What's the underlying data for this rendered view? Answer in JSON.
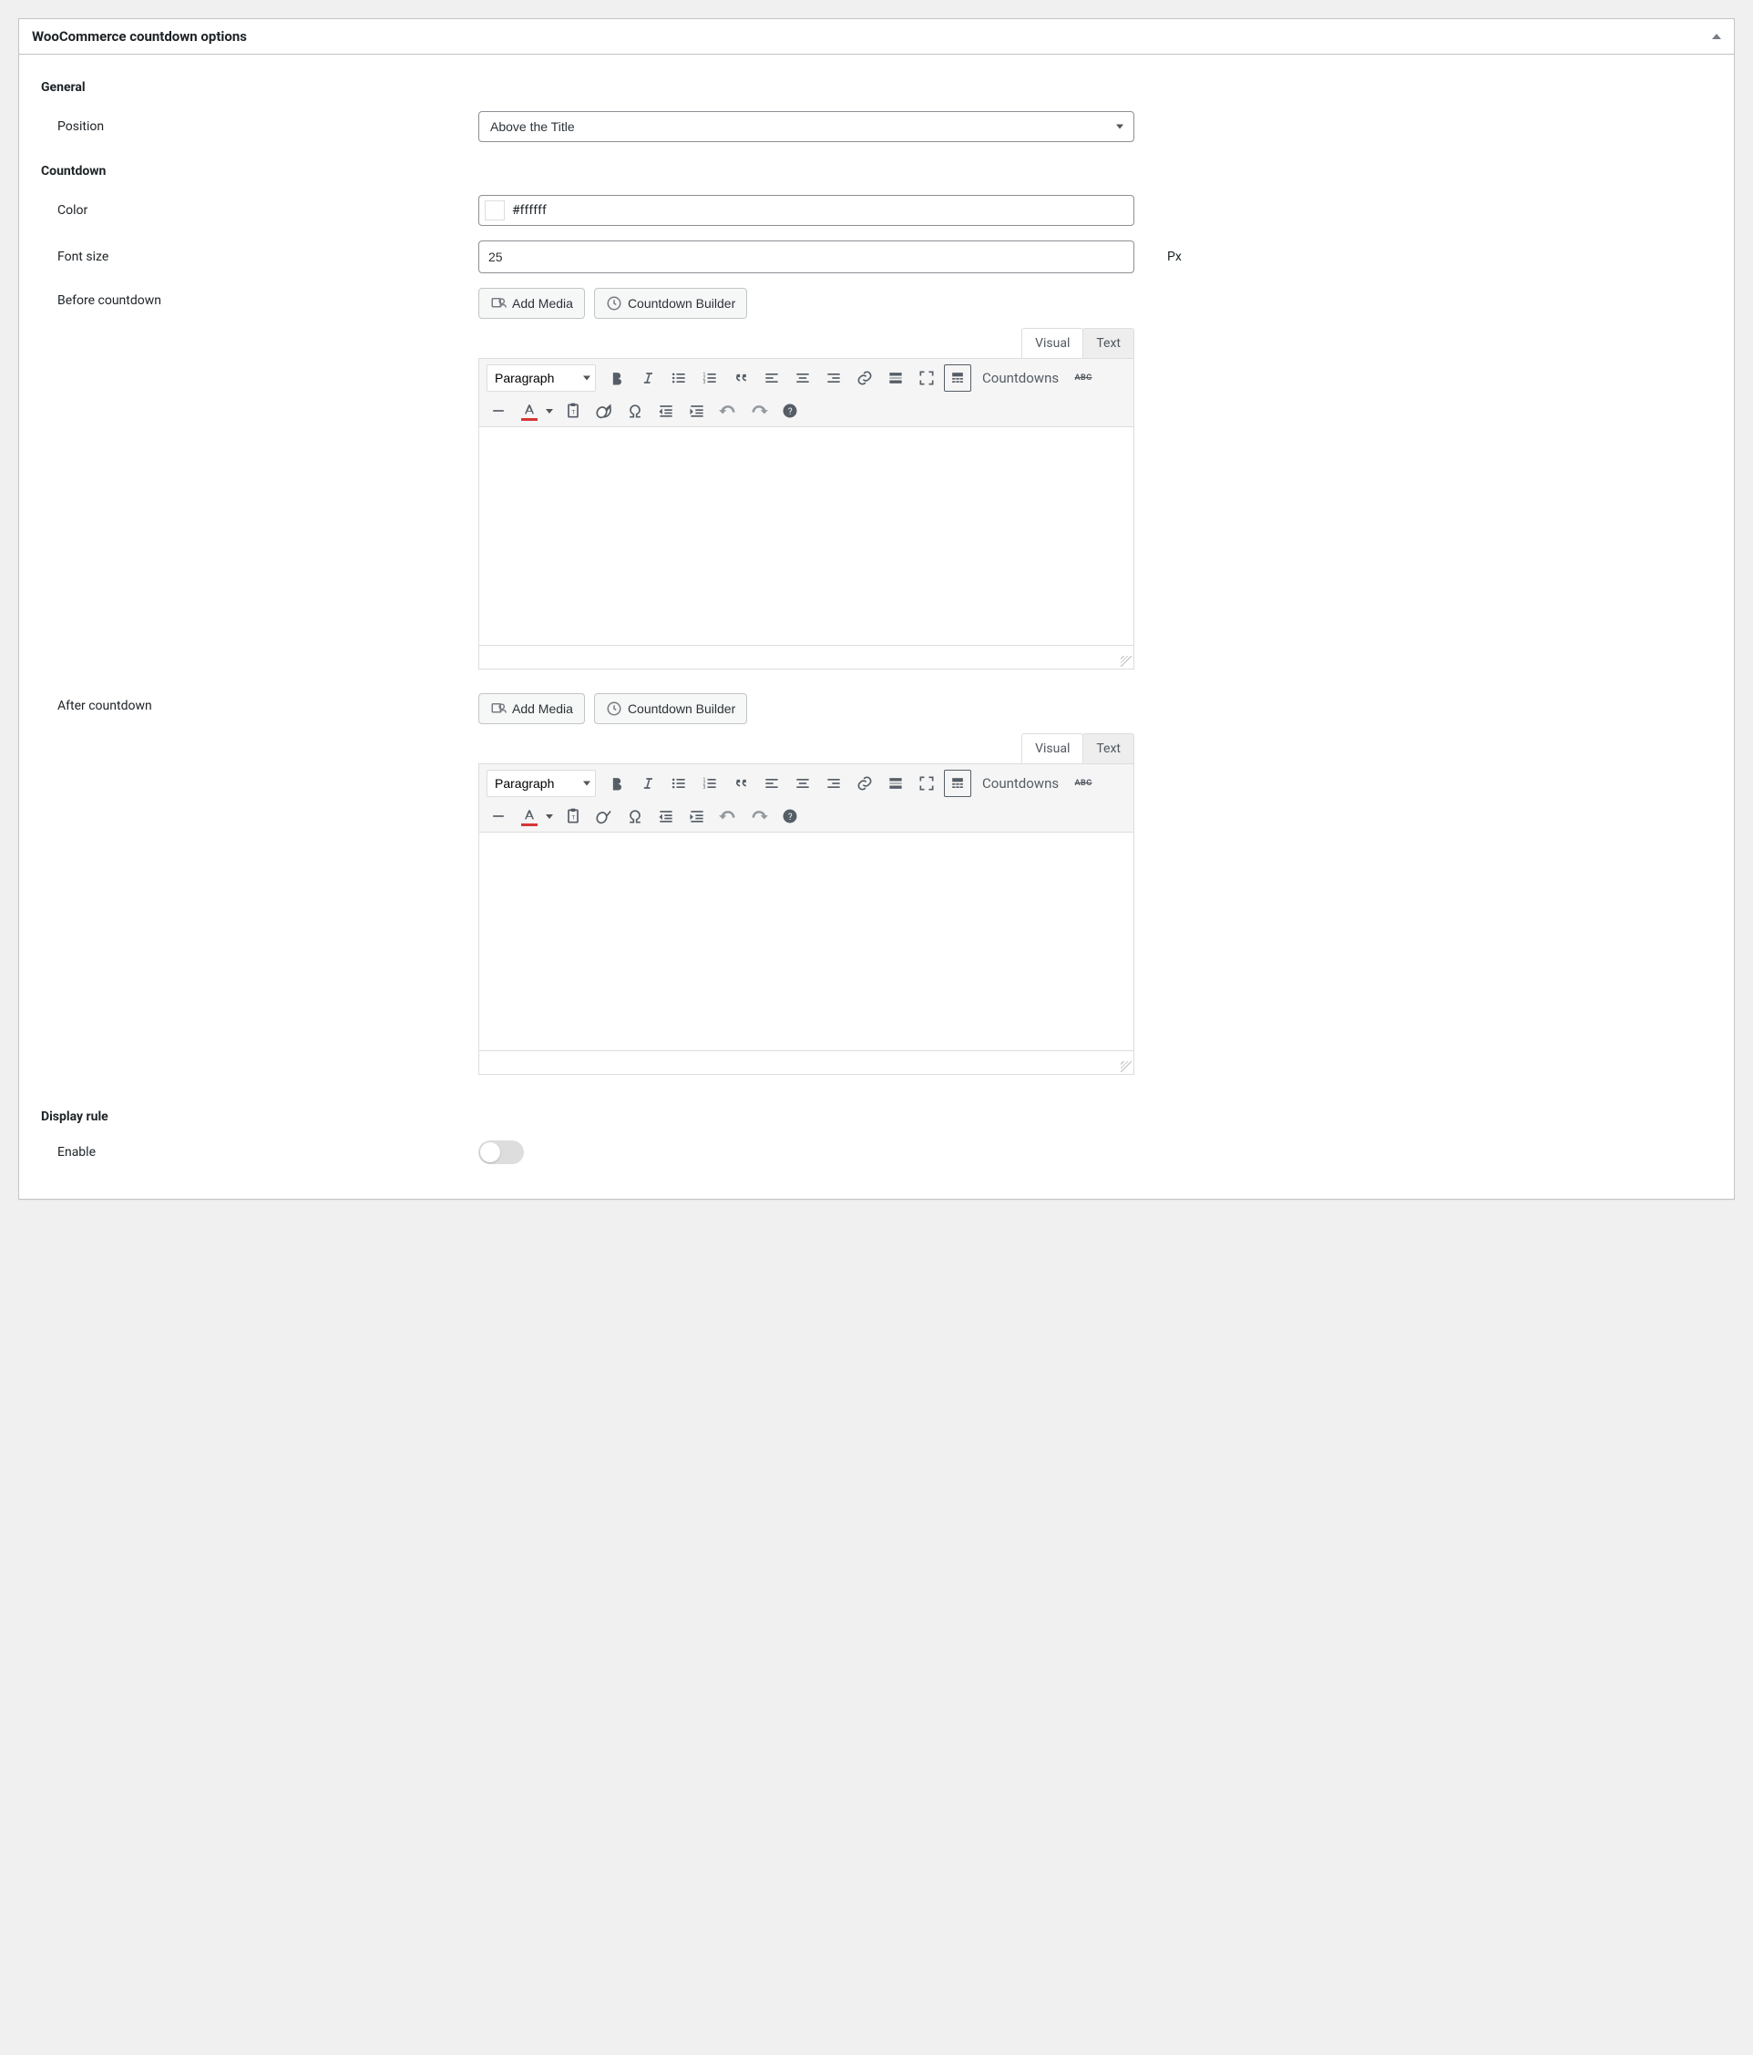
{
  "panel": {
    "title": "WooCommerce countdown options"
  },
  "sections": {
    "general": "General",
    "countdown": "Countdown",
    "display_rule": "Display rule"
  },
  "fields": {
    "position": {
      "label": "Position",
      "value": "Above the Title"
    },
    "color": {
      "label": "Color",
      "value": "#ffffff"
    },
    "font_size": {
      "label": "Font size",
      "value": "25",
      "unit": "Px"
    },
    "before_countdown": {
      "label": "Before countdown"
    },
    "after_countdown": {
      "label": "After countdown"
    },
    "enable": {
      "label": "Enable"
    }
  },
  "buttons": {
    "add_media": "Add Media",
    "countdown_builder": "Countdown Builder"
  },
  "editor": {
    "tabs": {
      "visual": "Visual",
      "text": "Text"
    },
    "format": "Paragraph",
    "countdowns_btn": "Countdowns",
    "abc": "ABC"
  }
}
